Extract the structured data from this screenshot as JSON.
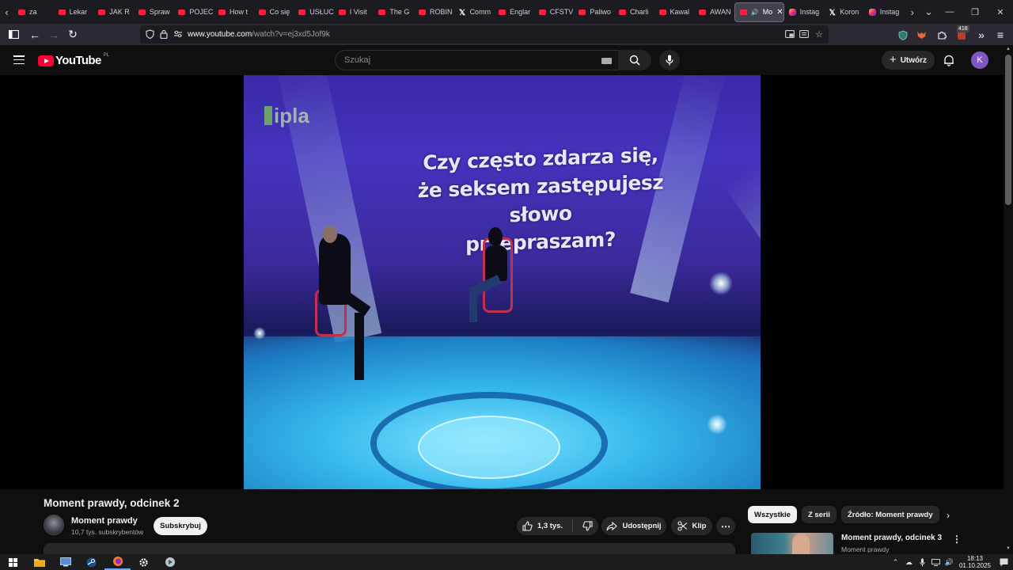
{
  "browser": {
    "tabs": [
      {
        "label": "za",
        "favicon": "youtube"
      },
      {
        "label": "Lekar",
        "favicon": "youtube"
      },
      {
        "label": "JAK R",
        "favicon": "youtube"
      },
      {
        "label": "Spraw",
        "favicon": "youtube"
      },
      {
        "label": "POJEC",
        "favicon": "youtube"
      },
      {
        "label": "How t",
        "favicon": "youtube"
      },
      {
        "label": "Co się",
        "favicon": "youtube"
      },
      {
        "label": "USŁUC",
        "favicon": "youtube"
      },
      {
        "label": "I Visit",
        "favicon": "youtube"
      },
      {
        "label": "The G",
        "favicon": "youtube"
      },
      {
        "label": "ROBIN",
        "favicon": "youtube"
      },
      {
        "label": "Comm",
        "favicon": "x"
      },
      {
        "label": "Englar",
        "favicon": "youtube"
      },
      {
        "label": "CFSTV",
        "favicon": "youtube"
      },
      {
        "label": "Paliwo",
        "favicon": "youtube"
      },
      {
        "label": "Charli",
        "favicon": "youtube"
      },
      {
        "label": "Kawal",
        "favicon": "youtube"
      },
      {
        "label": "AWAN",
        "favicon": "youtube"
      }
    ],
    "active_tab": {
      "label": "Mo",
      "favicon": "youtube"
    },
    "tabs_after": [
      {
        "label": "Instag",
        "favicon": "instagram"
      },
      {
        "label": "Koron",
        "favicon": "x"
      },
      {
        "label": "Instag",
        "favicon": "instagram"
      }
    ],
    "url_domain": "www.youtube.com",
    "url_path": "/watch?v=ej3xd5Jof9k",
    "extension_badge": "418"
  },
  "yt_header": {
    "logo_word": "YouTube",
    "logo_country": "PL",
    "search_placeholder": "Szukaj",
    "create_label": "Utwórz",
    "avatar_letter": "K"
  },
  "video": {
    "caption_lines": [
      "Czy często zdarza się,",
      "że seksem zastępujesz słowo",
      "przepraszam?"
    ],
    "channel_watermark": "ipla",
    "title": "Moment prawdy, odcinek 2"
  },
  "channel": {
    "name": "Moment prawdy",
    "subscribers": "10,7 tys. subskrybentów",
    "subscribe_label": "Subskrybuj"
  },
  "actions": {
    "likes": "1,3 tys.",
    "share_label": "Udostępnij",
    "clip_label": "Klip"
  },
  "chips": [
    "Wszystkie",
    "Z serii",
    "Źródło: Moment prawdy"
  ],
  "recommendation": {
    "title": "Moment prawdy, odcinek 3",
    "channel": "Moment prawdy"
  },
  "taskbar": {
    "time": "18:13",
    "date": "01.10.2025"
  },
  "colors": {
    "youtube_red": "#ff0033",
    "background": "#0f0f0f",
    "browser_chrome": "#1c1b22",
    "avatar_purple": "#7e57c2"
  }
}
